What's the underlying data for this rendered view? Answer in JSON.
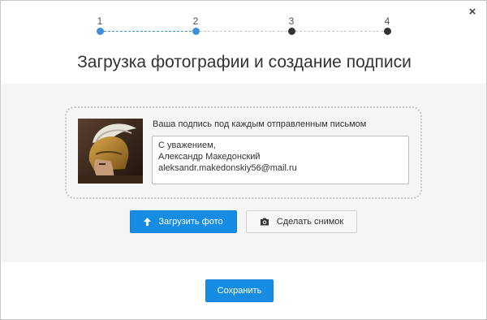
{
  "dialog": {
    "close_label": "×",
    "title": "Загрузка фотографии и создание подписи"
  },
  "steps": [
    {
      "number": "1",
      "state": "done"
    },
    {
      "number": "2",
      "state": "done"
    },
    {
      "number": "3",
      "state": "todo"
    },
    {
      "number": "4",
      "state": "todo"
    }
  ],
  "signature": {
    "label": "Ваша подпись под каждым отправленным письмом",
    "lines": [
      "С уважением,",
      "Александр Македонский",
      "aleksandr.makedonskiy56@mail.ru"
    ]
  },
  "buttons": {
    "upload": {
      "label": "Загрузить фото",
      "icon": "arrow-up-icon"
    },
    "snapshot": {
      "label": "Сделать снимок",
      "icon": "camera-icon"
    },
    "save": {
      "label": "Сохранить"
    }
  },
  "colors": {
    "accent": "#168de2",
    "step_done": "#3d8fdb",
    "step_todo": "#333333"
  }
}
